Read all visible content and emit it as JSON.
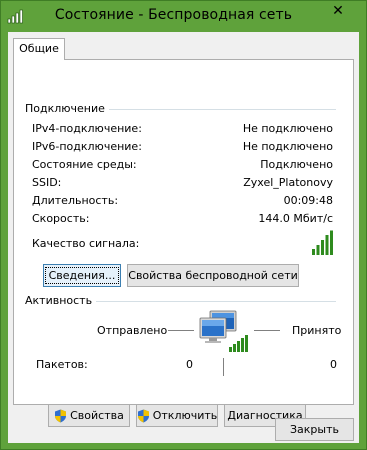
{
  "window": {
    "title": "Состояние - Беспроводная сеть",
    "close_glyph": "✕",
    "title_icon": "wifi-signal-icon"
  },
  "tab": {
    "label": "Общие"
  },
  "connection": {
    "group_title": "Подключение",
    "rows": [
      {
        "label": "IPv4-подключение:",
        "value": "Не подключено"
      },
      {
        "label": "IPv6-подключение:",
        "value": "Не подключено"
      },
      {
        "label": "Состояние среды:",
        "value": "Подключено"
      },
      {
        "label": "SSID:",
        "value": "Zyxel_Platonovy"
      },
      {
        "label": "Длительность:",
        "value": "00:09:48"
      },
      {
        "label": "Скорость:",
        "value": "144.0 Мбит/с"
      }
    ],
    "signal_label": "Качество сигнала:",
    "signal_icon": "signal-bars-icon",
    "signal_bars_filled": 5,
    "signal_bars_total": 5
  },
  "buttons": {
    "details": "Сведения...",
    "wireless_props": "Свойства беспроводной сети",
    "properties": "Свойства",
    "disable": "Отключить",
    "diagnostics": "Диагностика",
    "close": "Закрыть"
  },
  "activity": {
    "group_title": "Активность",
    "sent_label": "Отправлено",
    "received_label": "Принято",
    "packets_label": "Пакетов:",
    "packets_sent": "0",
    "packets_received": "0",
    "network_icon": "network-computer-icon"
  },
  "colors": {
    "frame": "#5fa23b",
    "panel": "#f0f0f0",
    "signal_green": "#2e8b1e",
    "focus_border": "#3c7fb1"
  }
}
